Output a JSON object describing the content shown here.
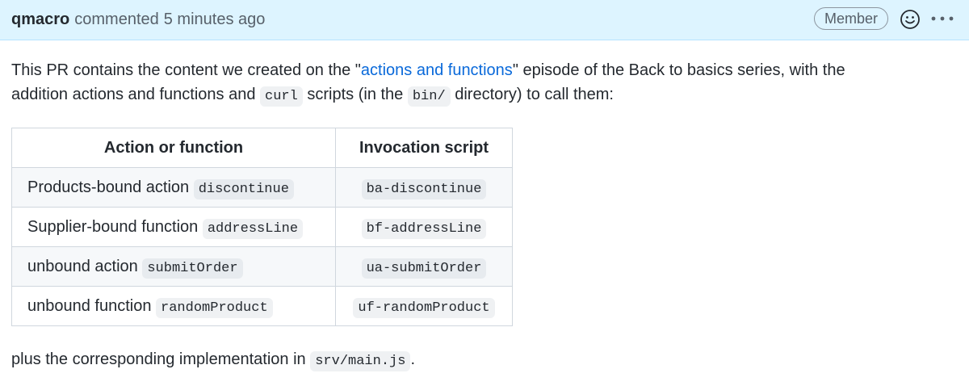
{
  "header": {
    "author": "qmacro",
    "action": "commented",
    "time": "5 minutes ago",
    "badge": "Member",
    "emoji_icon": "smiley-icon",
    "more_icon": "kebab-horizontal-icon"
  },
  "body": {
    "intro_part1": "This PR contains the content we created on the \"",
    "intro_link": "actions and functions",
    "intro_part2": "\" episode of the Back to basics series, with the",
    "intro_part3": "addition actions and functions and ",
    "intro_code1": "curl",
    "intro_part4": " scripts (in the ",
    "intro_code2": "bin/",
    "intro_part5": " directory) to call them:",
    "outro_part1": "plus the corresponding implementation in ",
    "outro_code": "srv/main.js",
    "outro_part2": "."
  },
  "table": {
    "headers": [
      "Action or function",
      "Invocation script"
    ],
    "rows": [
      {
        "label": "Products-bound action ",
        "code": "discontinue",
        "script": "ba-discontinue"
      },
      {
        "label": "Supplier-bound function ",
        "code": "addressLine",
        "script": "bf-addressLine"
      },
      {
        "label": "unbound action ",
        "code": "submitOrder",
        "script": "ua-submitOrder"
      },
      {
        "label": "unbound function ",
        "code": "randomProduct",
        "script": "uf-randomProduct"
      }
    ]
  },
  "colors": {
    "header_bg": "#ddf4ff",
    "link": "#0969da",
    "text": "#24292f",
    "muted": "#57606a"
  }
}
